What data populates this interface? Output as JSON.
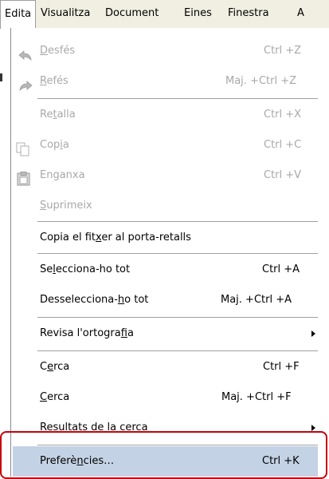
{
  "menubar": {
    "items": [
      {
        "name": "Edita",
        "pre": "",
        "u": "",
        "post": "Edita"
      },
      {
        "name": "Visualitza",
        "pre": "",
        "u": "",
        "post": "Visualitza"
      },
      {
        "name": "Document",
        "pre": "",
        "u": "",
        "post": "Document"
      },
      {
        "name": "Eines",
        "pre": "",
        "u": "",
        "post": "Eines"
      },
      {
        "name": "Finestra",
        "pre": "",
        "u": "",
        "post": "Finestra"
      },
      {
        "name": "A",
        "pre": "",
        "u": "",
        "post": "A"
      }
    ],
    "active_index": 0
  },
  "menu": {
    "undo": {
      "pre": "",
      "u": "D",
      "post": "esfés",
      "shortcut": "Ctrl +Z",
      "icon": "undo-icon",
      "disabled": true
    },
    "redo": {
      "pre": "",
      "u": "R",
      "post": "efés",
      "shortcut": "Maj. +Ctrl +Z",
      "icon": "redo-icon",
      "disabled": true
    },
    "cut": {
      "pre": "Re",
      "u": "t",
      "post": "alla",
      "shortcut": "Ctrl +X",
      "disabled": true
    },
    "copy": {
      "pre": "Cop",
      "u": "i",
      "post": "a",
      "shortcut": "Ctrl +C",
      "icon": "copy-icon",
      "disabled": true
    },
    "paste": {
      "pre": "En",
      "u": "g",
      "post": "anxa",
      "shortcut": "Ctrl +V",
      "icon": "paste-icon",
      "disabled": true
    },
    "delete": {
      "pre": "",
      "u": "S",
      "post": "uprimeix",
      "disabled": true
    },
    "copy_file": {
      "pre": "Copia el fit",
      "u": "x",
      "post": "er al porta-retalls"
    },
    "select_all": {
      "pre": "Se",
      "u": "l",
      "post": "ecciona-ho tot",
      "shortcut": "Ctrl +A"
    },
    "deselect_all": {
      "pre": "Desselecciona-",
      "u": "h",
      "post": "o tot",
      "shortcut": "Maj. +Ctrl +A"
    },
    "spell_check": {
      "pre": "Revisa l'ortogra",
      "u": "f",
      "post": "ia",
      "submenu": true
    },
    "find": {
      "pre": "C",
      "u": "e",
      "post": "rca",
      "shortcut": "Ctrl +F"
    },
    "search": {
      "pre": "",
      "u": "C",
      "post": "erca",
      "shortcut": "Maj. +Ctrl +F"
    },
    "search_results": {
      "pre": "Resultats de la cerc",
      "u": "a",
      "post": "",
      "submenu": true
    },
    "preferences": {
      "pre": "Preferè",
      "u": "n",
      "post": "cies…",
      "shortcut": "Ctrl +K",
      "highlighted": true
    }
  },
  "colors": {
    "menubar_bg": "#f1efe2",
    "highlight_bg": "#c4d2e5",
    "disabled_text": "#a8a8a8",
    "callout_border": "#c8000a"
  }
}
